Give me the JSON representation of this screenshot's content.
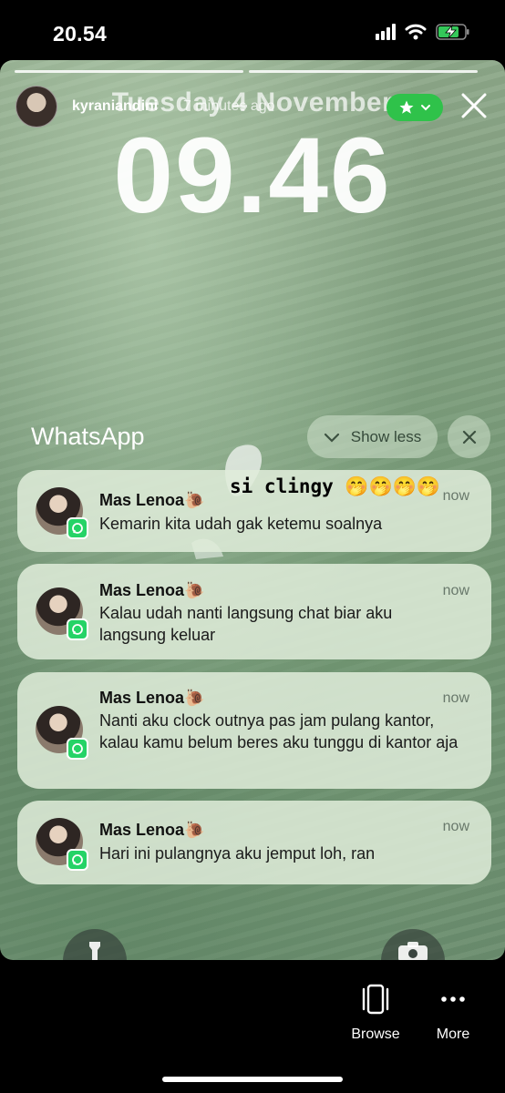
{
  "status_bar": {
    "time": "20.54"
  },
  "story": {
    "username": "kyraniandini",
    "posted_ago": "7 minutes ago",
    "close_friends_color": "#2fc24a",
    "sticker_text": "si clingy 🤭🤭🤭🤭"
  },
  "lockscreen": {
    "date": "Tuesday 4 November",
    "time": "09.46",
    "group_title": "WhatsApp",
    "show_less_label": "Show less",
    "notifications": [
      {
        "sender": "Mas Lenoa🐌",
        "time": "now",
        "body": "Kemarin kita udah gak ketemu soalnya"
      },
      {
        "sender": "Mas Lenoa🐌",
        "time": "now",
        "body": "Kalau udah nanti langsung chat biar aku langsung keluar"
      },
      {
        "sender": "Mas Lenoa🐌",
        "time": "now",
        "body": "Nanti aku clock outnya pas jam pulang kantor, kalau kamu belum beres aku tunggu di kantor aja"
      },
      {
        "sender": "Mas Lenoa🐌",
        "time": "now",
        "body": "Hari ini pulangnya aku jemput loh, ran"
      }
    ]
  },
  "bottom_bar": {
    "browse_label": "Browse",
    "more_label": "More"
  },
  "icons": [
    "signal-icon",
    "wifi-icon",
    "battery-charging-icon",
    "close-icon",
    "star-icon",
    "chevron-down-icon",
    "whatsapp-icon",
    "flashlight-icon",
    "camera-icon",
    "browse-icon",
    "more-icon"
  ]
}
